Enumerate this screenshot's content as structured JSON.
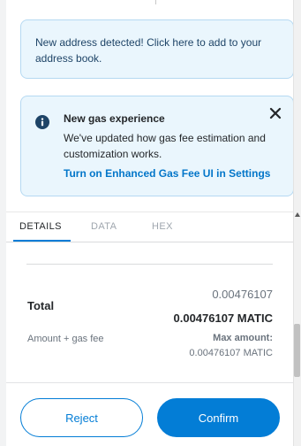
{
  "address_alert": {
    "text": "New address detected! Click here to add to your address book."
  },
  "gas_alert": {
    "title": "New gas experience",
    "body": "We've updated how gas fee estimation and customization works.",
    "link": "Turn on Enhanced Gas Fee UI in Settings"
  },
  "tabs": [
    {
      "label": "DETAILS",
      "active": true
    },
    {
      "label": "DATA",
      "active": false
    },
    {
      "label": "HEX",
      "active": false
    }
  ],
  "details": {
    "total_label": "Total",
    "total_fiat": "0.00476107",
    "total_native": "0.00476107 MATIC",
    "amount_gas_label": "Amount + gas fee",
    "max_amount_label": "Max amount:",
    "max_amount_value": "0.00476107 MATIC"
  },
  "footer": {
    "reject_label": "Reject",
    "confirm_label": "Confirm"
  },
  "colors": {
    "primary": "#037dd6",
    "alert_bg": "#eaf6fd",
    "alert_border": "#b5d9f2"
  },
  "icons": {
    "info": "info-icon",
    "close": "close-icon"
  }
}
